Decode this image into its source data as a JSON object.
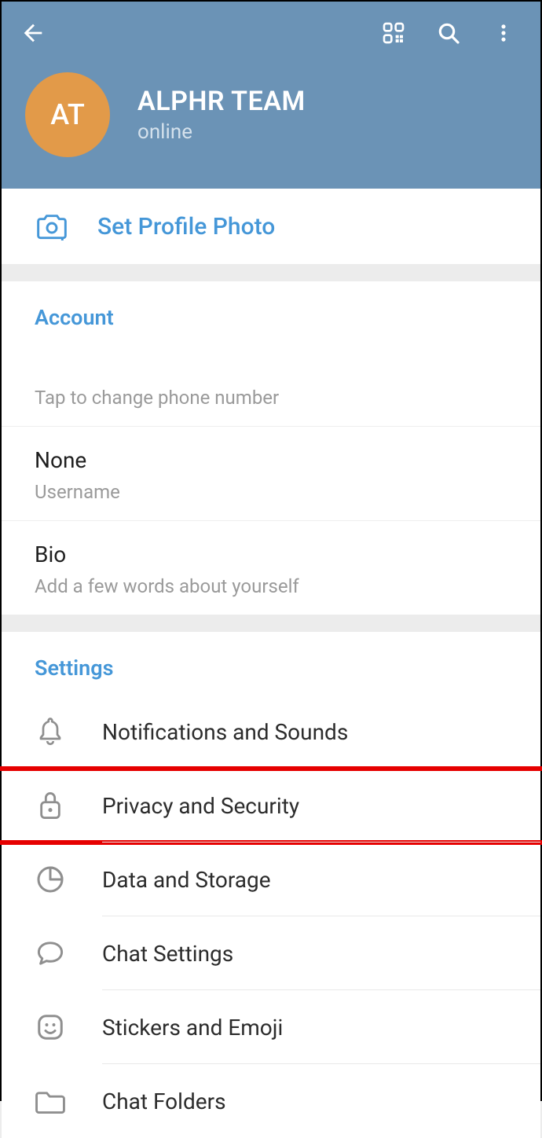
{
  "header": {
    "avatar_initials": "AT",
    "name": "ALPHR TEAM",
    "status": "online"
  },
  "set_photo": {
    "label": "Set Profile Photo"
  },
  "account": {
    "title": "Account",
    "phone": {
      "primary": "",
      "secondary": "Tap to change phone number"
    },
    "username": {
      "primary": "None",
      "secondary": "Username"
    },
    "bio": {
      "primary": "Bio",
      "secondary": "Add a few words about yourself"
    }
  },
  "settings": {
    "title": "Settings",
    "items": [
      {
        "icon": "bell-icon",
        "label": "Notifications and Sounds",
        "highlight": false
      },
      {
        "icon": "lock-icon",
        "label": "Privacy and Security",
        "highlight": true
      },
      {
        "icon": "storage-icon",
        "label": "Data and Storage",
        "highlight": false
      },
      {
        "icon": "chat-icon",
        "label": "Chat Settings",
        "highlight": false
      },
      {
        "icon": "sticker-icon",
        "label": "Stickers and Emoji",
        "highlight": false
      },
      {
        "icon": "folder-icon",
        "label": "Chat Folders",
        "highlight": false
      }
    ]
  }
}
